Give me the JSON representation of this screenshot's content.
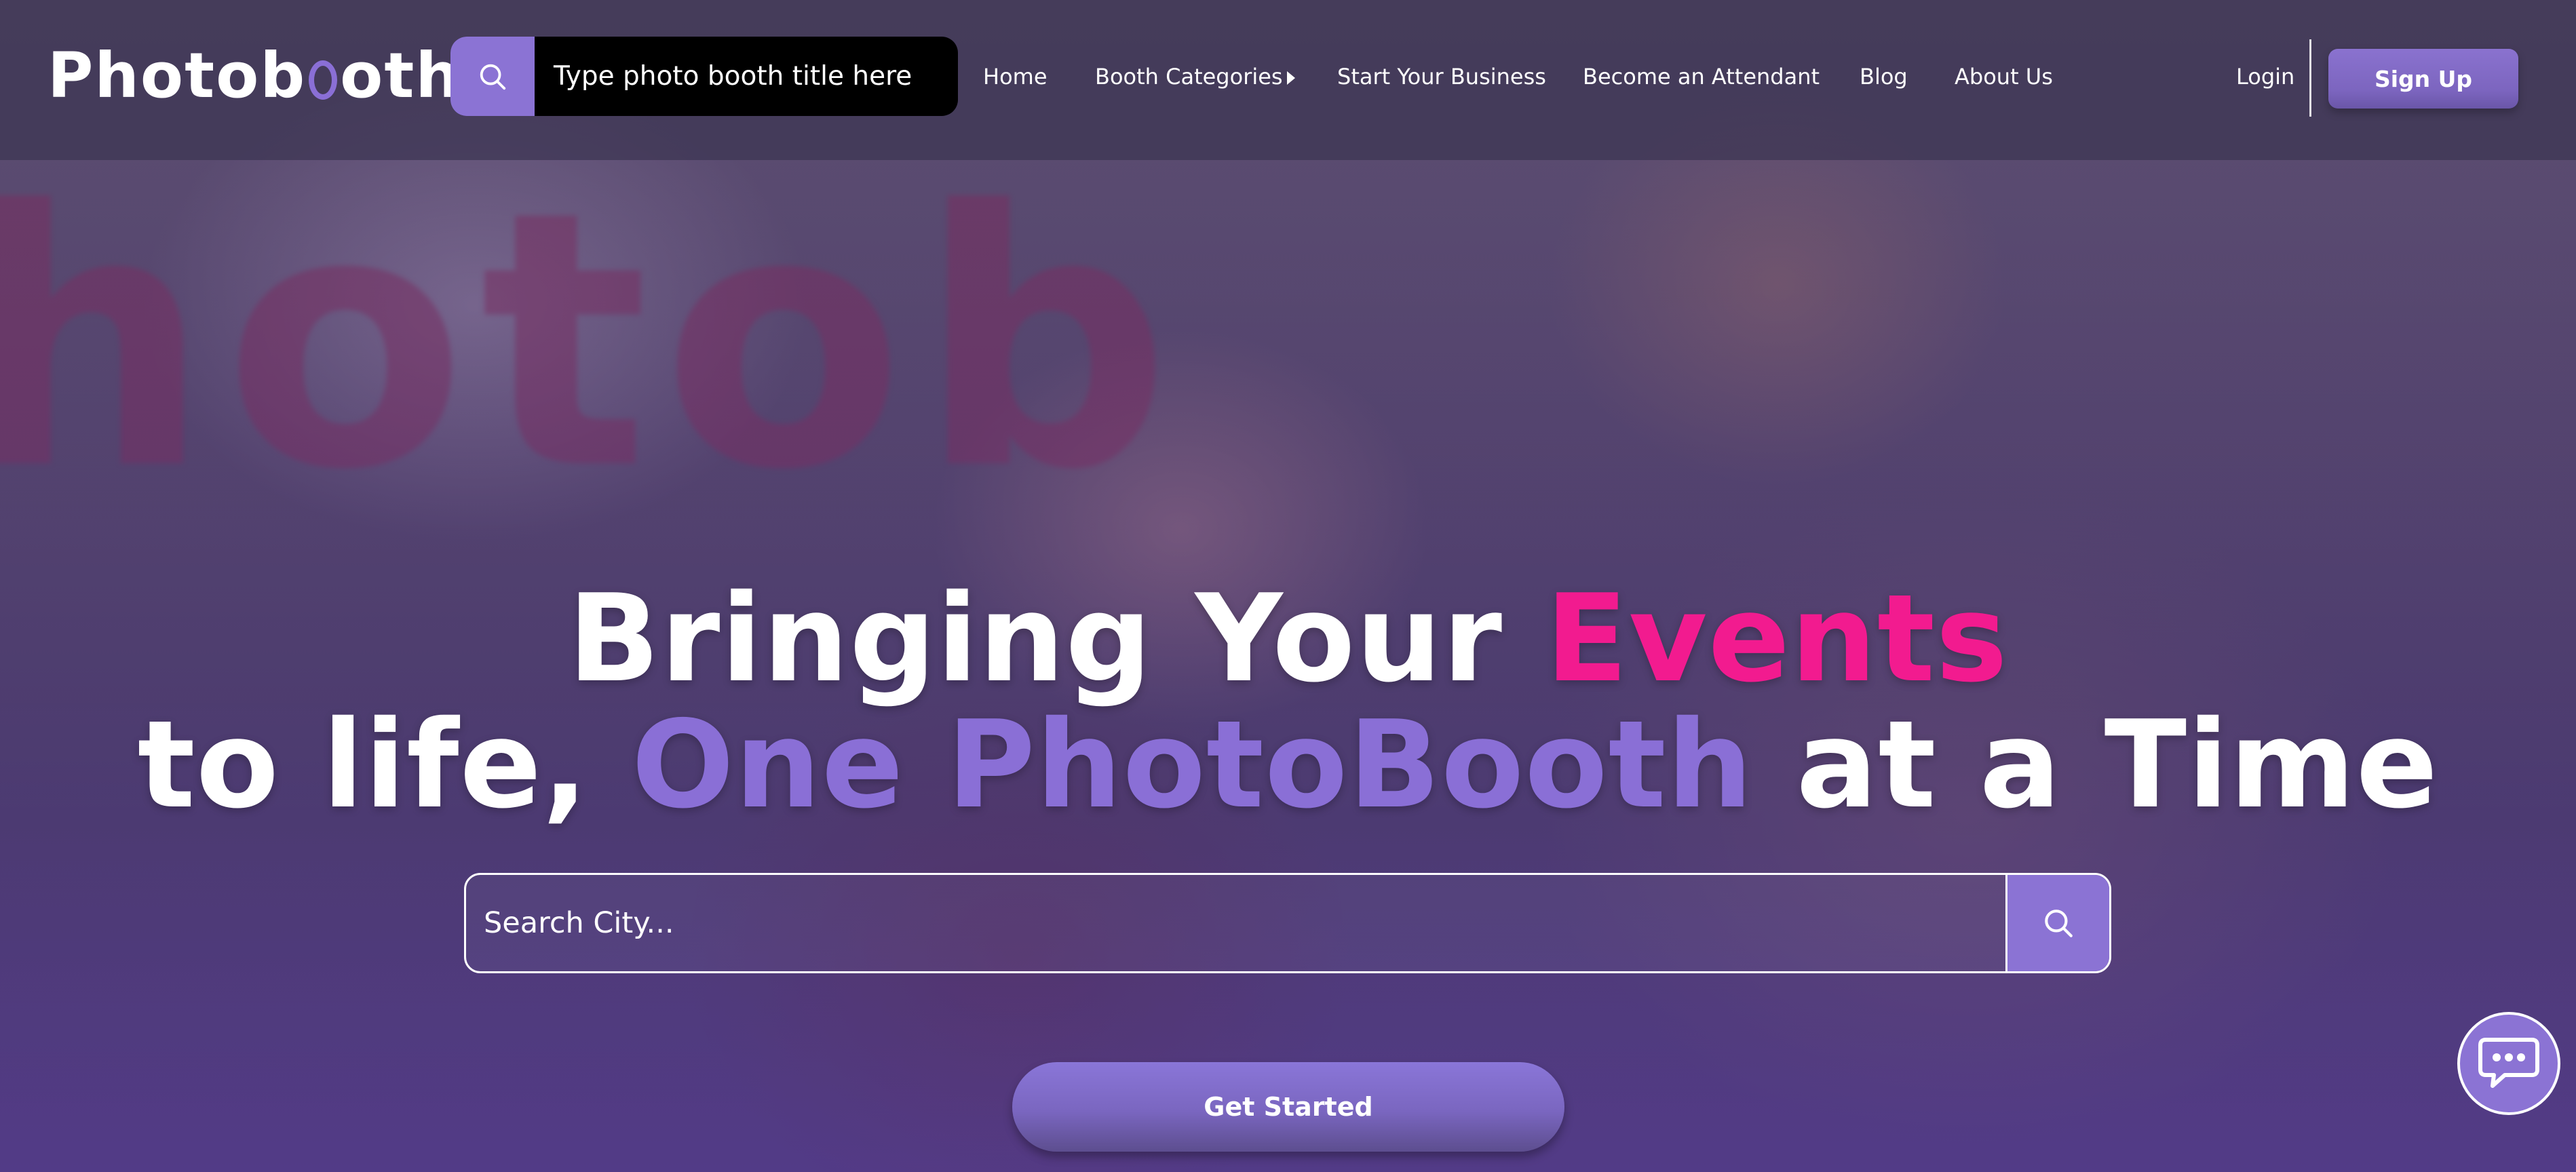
{
  "brand": {
    "logo_prefix": "Photob",
    "logo_suffix": "othify",
    "accent_color": "#8b73d4",
    "highlight_color": "#f21b8f"
  },
  "header": {
    "search_placeholder": "Type photo booth title here",
    "nav": [
      {
        "label": "Home"
      },
      {
        "label": "Booth Categories"
      },
      {
        "label": "Start Your Business"
      },
      {
        "label": "Become an Attendant"
      },
      {
        "label": "Blog"
      },
      {
        "label": "About Us"
      }
    ],
    "login_label": "Login",
    "signup_label": "Sign Up"
  },
  "hero": {
    "background_text": "hotob",
    "line1_plain": "Bringing Your ",
    "line1_highlight": "Events",
    "line2_plain_start": "to life, ",
    "line2_highlight": "One PhotoBooth",
    "line2_plain_end": " at a Time",
    "city_placeholder": "Search City...",
    "cta_label": "Get Started"
  },
  "icons": {
    "search": "search-icon",
    "chat": "chat-icon",
    "caret": "caret-right-icon"
  }
}
